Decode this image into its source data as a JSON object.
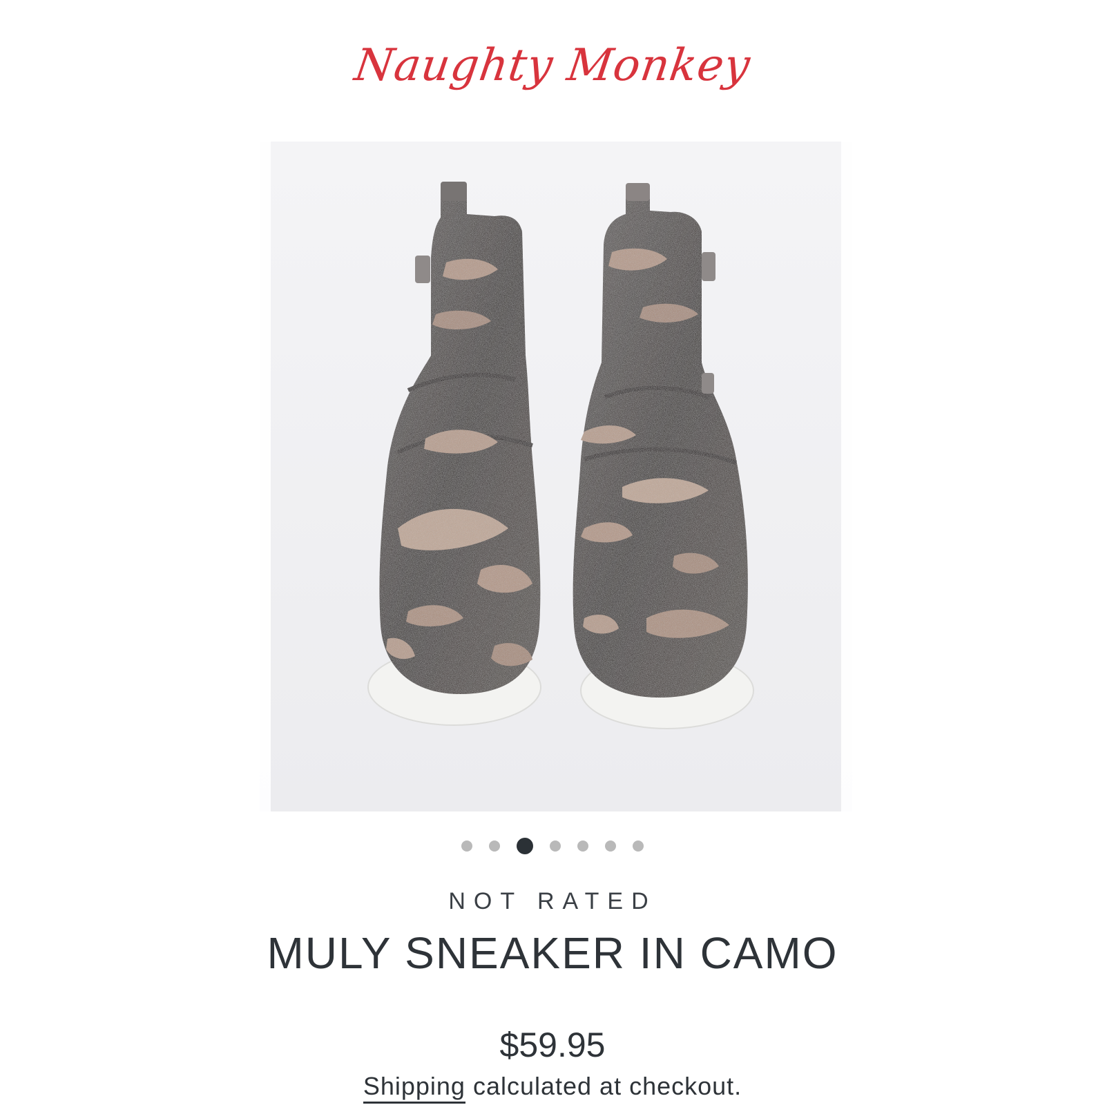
{
  "header": {
    "logo_text": "Naughty Monkey",
    "logo_color": "#d8343d"
  },
  "gallery": {
    "image_subject": "pair of glittery camo high-top sneakers with white soles",
    "dots": [
      {
        "active": false
      },
      {
        "active": false
      },
      {
        "active": true
      },
      {
        "active": false
      },
      {
        "active": false
      },
      {
        "active": false
      },
      {
        "active": false
      }
    ]
  },
  "product": {
    "rating_text": "NOT RATED",
    "title": "MULY SNEAKER IN CAMO",
    "price": "$59.95",
    "shipping_link_text": "Shipping",
    "shipping_rest_text": " calculated at checkout."
  }
}
